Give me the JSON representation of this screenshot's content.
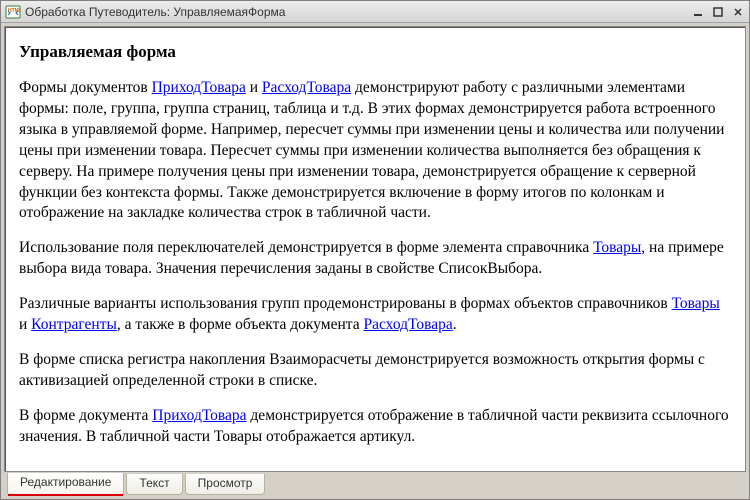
{
  "window": {
    "title": "Обработка Путеводитель: УправляемаяФорма"
  },
  "doc": {
    "heading": "Управляемая форма",
    "p1_pre": "Формы документов ",
    "p1_link1": "ПриходТовара",
    "p1_mid1": " и ",
    "p1_link2": "РасходТовара",
    "p1_post": " демонстрируют работу с различными элементами формы: поле, группа, группа страниц, таблица и т.д. В этих формах демонстрируется работа встроенного языка в управляемой форме. Например, пересчет суммы при изменении цены и количества или получении цены при изменении товара. Пересчет суммы  при изменении  количества выполняется без обращения к серверу. На примере получения цены при изменении товара, демонстрируется обращение к серверной функции без контекста формы. Также демонстрируется включение в форму итогов по колонкам и отображение на закладке количества строк в табличной части.",
    "p2_pre": "Использование поля переключателей демонстрируется в форме элемента справочника ",
    "p2_link": "Товары",
    "p2_post": ", на примере выбора вида товара. Значения перечисления заданы в свойстве СписокВыбора.",
    "p3_pre": "Различные варианты использования групп продемонстрированы в формах объектов справочников ",
    "p3_link1": "Товары",
    "p3_mid1": " и ",
    "p3_link2": "Контрагенты",
    "p3_mid2": ", а также в форме объекта документа ",
    "p3_link3": "РасходТовара",
    "p3_post": ".",
    "p4": "В форме списка регистра накопления Взаиморасчеты демонстрируется возможность открытия формы с активизацией определенной строки в списке.",
    "p5_pre": "В форме документа ",
    "p5_link": "ПриходТовара",
    "p5_post": " демонстрируется отображение в табличной части реквизита ссылочного значения. В табличной части Товары отображается артикул."
  },
  "tabs": {
    "edit": "Редактирование",
    "text": "Текст",
    "preview": "Просмотр"
  }
}
